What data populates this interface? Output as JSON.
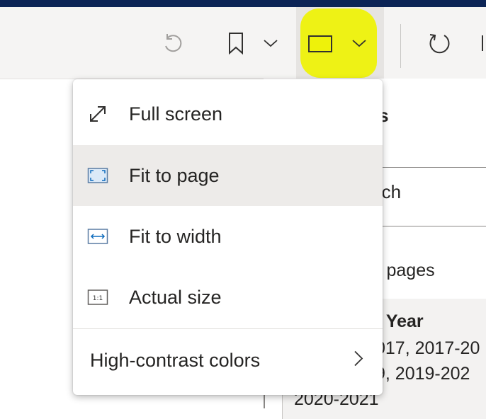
{
  "toolbar": {
    "buttons": [
      {
        "name": "reset-icon"
      },
      {
        "name": "bookmark-icon"
      },
      {
        "name": "chevron-down-icon"
      },
      {
        "name": "view-icon"
      },
      {
        "name": "refresh-icon"
      }
    ],
    "highlight_color": "#eef20a"
  },
  "side_panel": {
    "title_fragment": "rs",
    "search_placeholder_fragment": "rch",
    "pages_fragment": "l pages",
    "filter_title_fragment": ": Year",
    "filter_values": [
      "017, 2017-20",
      "9, 2019-202",
      "2020-2021"
    ]
  },
  "view_menu": {
    "items": [
      {
        "label": "Full screen",
        "icon": "full-screen-icon",
        "selected": false
      },
      {
        "label": "Fit to page",
        "icon": "fit-to-page-icon",
        "selected": true
      },
      {
        "label": "Fit to width",
        "icon": "fit-to-width-icon",
        "selected": false
      },
      {
        "label": "Actual size",
        "icon": "actual-size-icon",
        "selected": false
      }
    ],
    "submenu": {
      "label": "High-contrast colors",
      "icon": "chevron-right-icon"
    },
    "actual_size_glyph": "1:1"
  },
  "colors": {
    "accent_blue": "#0f6cbd",
    "top_bar": "#0c2456",
    "selected_bg": "#edebe9"
  }
}
